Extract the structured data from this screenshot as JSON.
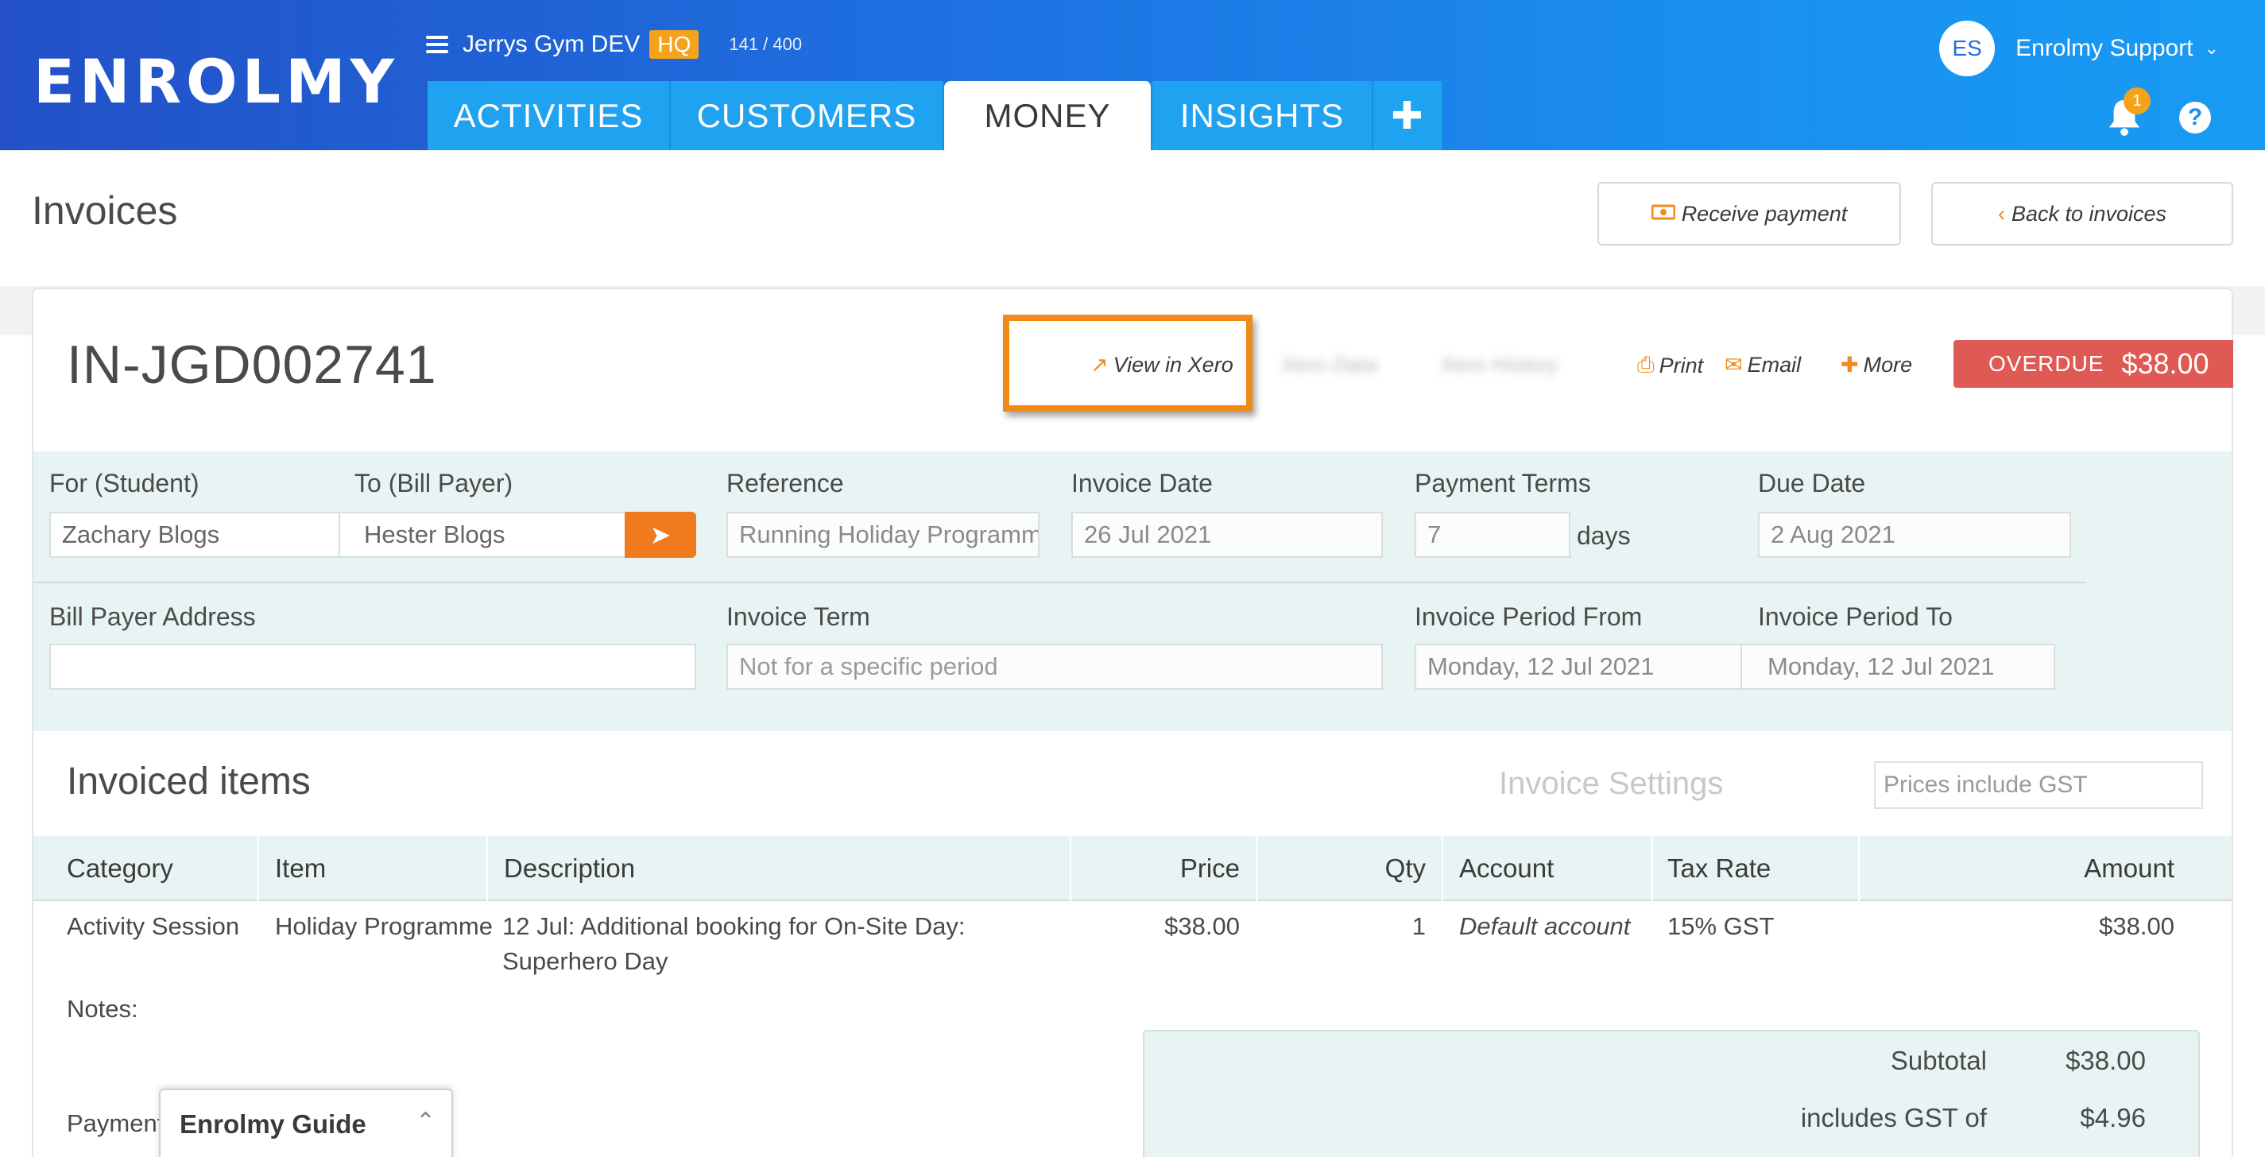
{
  "header": {
    "logo": "ENROLMY",
    "org_name": "Jerrys Gym DEV",
    "org_badge": "HQ",
    "count": "141 / 400",
    "tabs": [
      {
        "label": "ACTIVITIES"
      },
      {
        "label": "CUSTOMERS"
      },
      {
        "label": "MONEY"
      },
      {
        "label": "INSIGHTS"
      },
      {
        "label": "✚"
      }
    ],
    "user_initials": "ES",
    "user_name": "Enrolmy Support",
    "notification_count": "1",
    "help": "?"
  },
  "page": {
    "title": "Invoices",
    "receive_payment": "Receive payment",
    "back_to_invoices": "Back to invoices"
  },
  "invoice": {
    "number": "IN-JGD002741",
    "actions": {
      "view_in_xero": "View in Xero",
      "xero_data": "Xero Data",
      "xero_history": "Xero History",
      "print": "Print",
      "email": "Email",
      "more": "More"
    },
    "status": "OVERDUE",
    "status_amount": "$38.00",
    "form": {
      "for_label": "For (Student)",
      "for_value": "Zachary Blogs",
      "to_label": "To (Bill Payer)",
      "to_value": "Hester Blogs",
      "reference_label": "Reference",
      "reference_value": "Running Holiday Programme",
      "invoice_date_label": "Invoice Date",
      "invoice_date_value": "26 Jul 2021",
      "payment_terms_label": "Payment Terms",
      "payment_terms_value": "7",
      "payment_terms_unit": "days",
      "due_date_label": "Due Date",
      "due_date_value": "2 Aug 2021",
      "bill_payer_address_label": "Bill Payer Address",
      "bill_payer_address_value": "",
      "invoice_term_label": "Invoice Term",
      "invoice_term_placeholder": "Not for a specific period",
      "period_from_label": "Invoice Period From",
      "period_from_value": "Monday, 12 Jul 2021",
      "period_to_label": "Invoice Period To",
      "period_to_value": "Monday, 12 Jul 2021"
    },
    "items_title": "Invoiced items",
    "invoice_settings": "Invoice Settings",
    "gst_select": "Prices include GST",
    "columns": {
      "category": "Category",
      "item": "Item",
      "description": "Description",
      "price": "Price",
      "qty": "Qty",
      "account": "Account",
      "tax_rate": "Tax Rate",
      "amount": "Amount"
    },
    "rows": [
      {
        "category": "Activity Session",
        "item": "Holiday Programme",
        "description_line1": "12 Jul: Additional booking for On-Site Day:",
        "description_line2": "Superhero Day",
        "price": "$38.00",
        "qty": "1",
        "account": "Default account",
        "tax_rate": "15% GST",
        "amount": "$38.00"
      }
    ],
    "notes_label": "Notes:",
    "payment_label": "Payment",
    "totals": {
      "subtotal_label": "Subtotal",
      "subtotal_value": "$38.00",
      "gst_label": "includes GST of",
      "gst_value": "$4.96"
    }
  },
  "guide": {
    "title": "Enrolmy Guide"
  },
  "colors": {
    "header_start": "#2350c7",
    "header_end": "#179bf2",
    "accent_orange": "#f28a1a",
    "overdue_red": "#e05a55",
    "form_bg": "#e8f4f3"
  }
}
